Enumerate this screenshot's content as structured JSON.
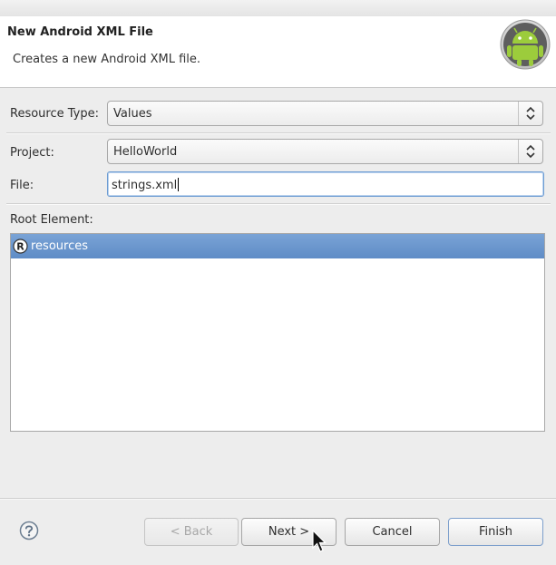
{
  "header": {
    "title": "New Android XML File",
    "description": "Creates a new Android XML file.",
    "logo_icon": "android-robot-icon"
  },
  "form": {
    "resource_type": {
      "label": "Resource Type:",
      "value": "Values"
    },
    "project": {
      "label": "Project:",
      "value": "HelloWorld"
    },
    "file": {
      "label": "File:",
      "value": "strings.xml"
    },
    "root_element": {
      "label": "Root Element:",
      "items": [
        {
          "icon": "registered-r-icon",
          "icon_glyph": "R",
          "label": "resources",
          "selected": true
        }
      ]
    }
  },
  "buttons": {
    "back": "< Back",
    "next": "Next >",
    "cancel": "Cancel",
    "finish": "Finish"
  },
  "colors": {
    "selection": "#6b96cd",
    "android_green": "#8cc63f"
  }
}
